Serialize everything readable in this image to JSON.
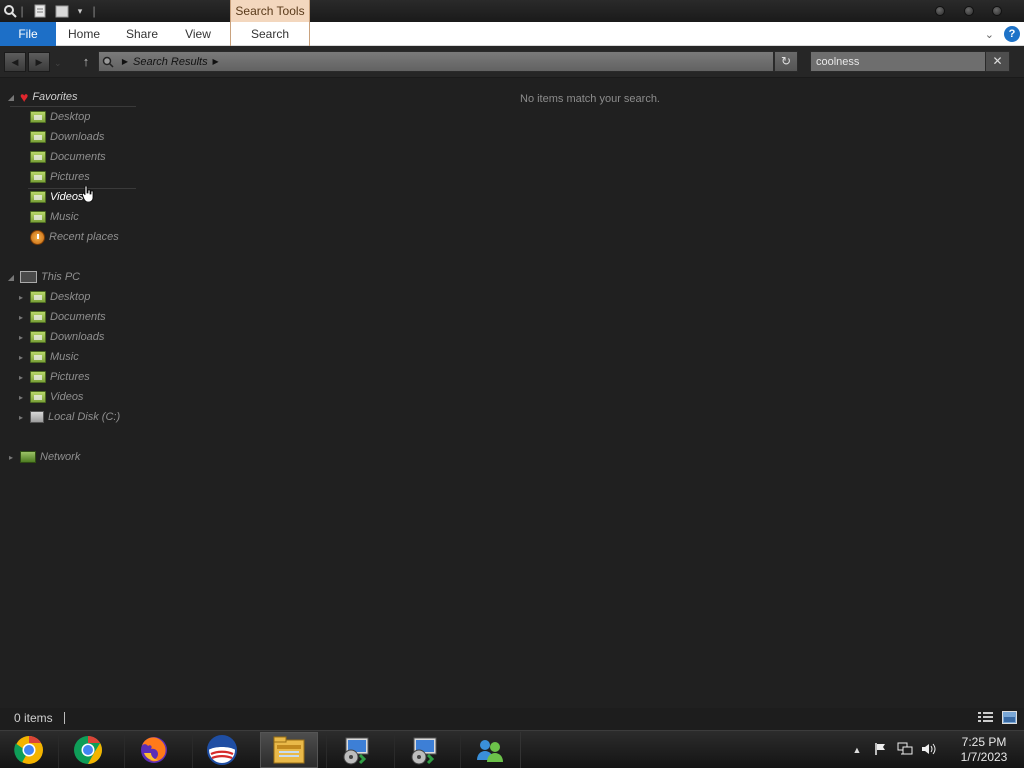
{
  "window": {
    "context_tab": "Search Tools"
  },
  "ribbon": {
    "tabs": [
      {
        "label": "File"
      },
      {
        "label": "Home"
      },
      {
        "label": "Share"
      },
      {
        "label": "View"
      },
      {
        "label": "Search"
      }
    ],
    "help_label": "?"
  },
  "address": {
    "crumb": "Search Results"
  },
  "search": {
    "value": "coolness"
  },
  "nav": {
    "favorites": {
      "label": "Favorites",
      "items": [
        {
          "label": "Desktop",
          "icon": "desktop-folder-icon"
        },
        {
          "label": "Downloads",
          "icon": "downloads-folder-icon"
        },
        {
          "label": "Documents",
          "icon": "documents-folder-icon"
        },
        {
          "label": "Pictures",
          "icon": "pictures-folder-icon"
        },
        {
          "label": "Videos",
          "icon": "videos-folder-icon"
        },
        {
          "label": "Music",
          "icon": "music-folder-icon"
        },
        {
          "label": "Recent places",
          "icon": "recent-places-icon"
        }
      ]
    },
    "this_pc": {
      "label": "This PC",
      "items": [
        {
          "label": "Desktop",
          "icon": "desktop-folder-icon"
        },
        {
          "label": "Documents",
          "icon": "documents-folder-icon"
        },
        {
          "label": "Downloads",
          "icon": "downloads-folder-icon"
        },
        {
          "label": "Music",
          "icon": "music-folder-icon"
        },
        {
          "label": "Pictures",
          "icon": "pictures-folder-icon"
        },
        {
          "label": "Videos",
          "icon": "videos-folder-icon"
        },
        {
          "label": "Local Disk (C:)",
          "icon": "drive-icon"
        }
      ]
    },
    "network": {
      "label": "Network"
    }
  },
  "content": {
    "empty_message": "No items match your search."
  },
  "status": {
    "item_count": "0 items"
  },
  "taskbar": {
    "apps": [
      {
        "name": "chrome-canary",
        "icon": "chrome-canary-icon"
      },
      {
        "name": "chrome",
        "icon": "chrome-icon"
      },
      {
        "name": "firefox",
        "icon": "firefox-icon"
      },
      {
        "name": "obama-campaign",
        "icon": "campaign-logo-icon"
      },
      {
        "name": "file-explorer",
        "icon": "file-explorer-icon"
      },
      {
        "name": "installer-1",
        "icon": "installer-icon"
      },
      {
        "name": "installer-2",
        "icon": "installer-icon"
      },
      {
        "name": "messenger",
        "icon": "messenger-icon"
      }
    ],
    "time": "7:25 PM",
    "date": "1/7/2023"
  }
}
